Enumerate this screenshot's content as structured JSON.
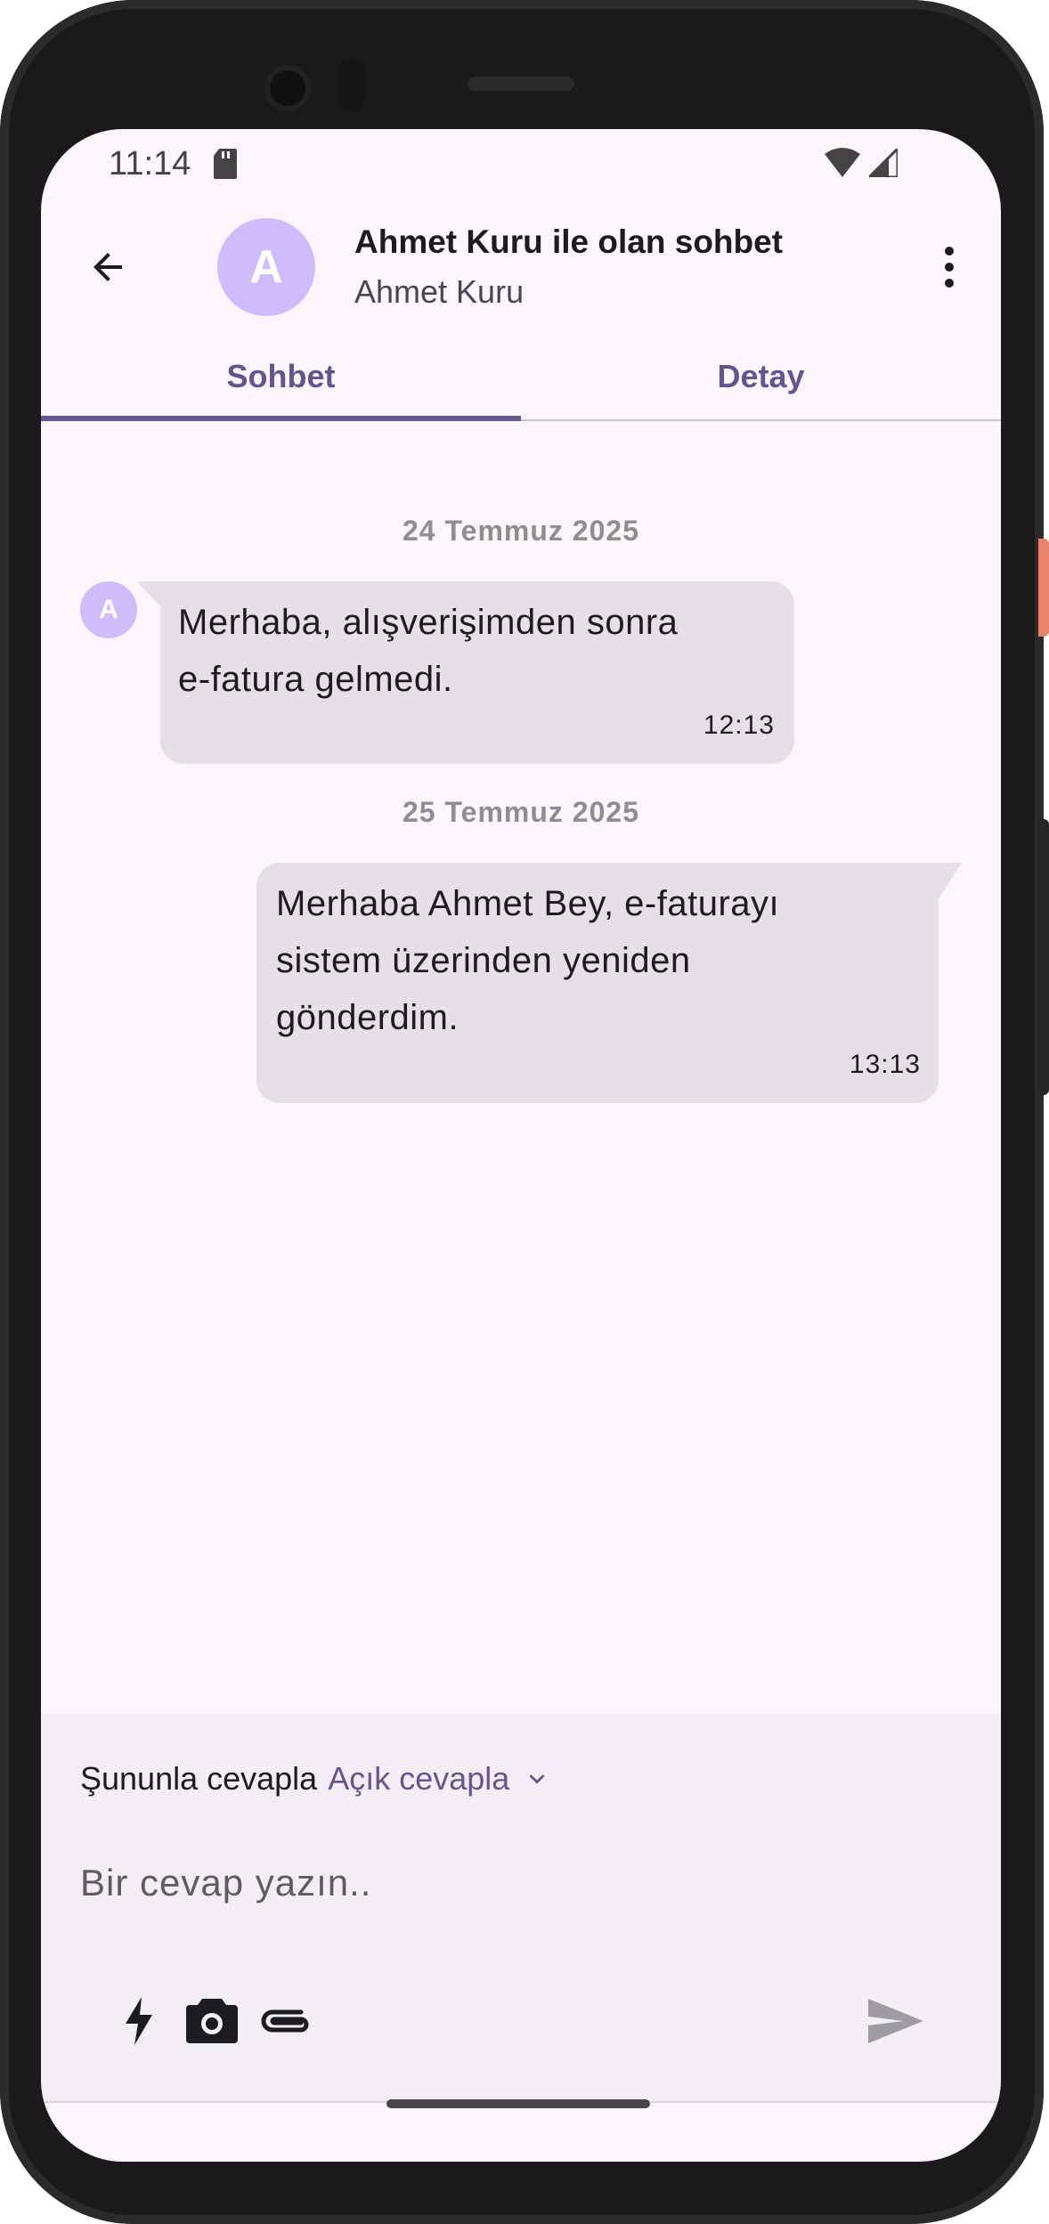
{
  "status_bar": {
    "time": "11:14"
  },
  "header": {
    "avatar_letter": "A",
    "title": "Ahmet Kuru ile olan sohbet",
    "subtitle": "Ahmet Kuru"
  },
  "tabs": [
    {
      "label": "Sohbet",
      "selected": true
    },
    {
      "label": "Detay",
      "selected": false
    }
  ],
  "messages": [
    {
      "date": "24 Temmuz 2025",
      "avatar_letter": "A",
      "lines": [
        "Merhaba, alışverişimden sonra",
        "e-fatura gelmedi."
      ],
      "time": "12:13",
      "direction": "incoming"
    },
    {
      "date": "25 Temmuz 2025",
      "lines": [
        "Merhaba Ahmet Bey, e-faturayı",
        "sistem üzerinden yeniden",
        "gönderdim."
      ],
      "time": "13:13",
      "direction": "outgoing"
    }
  ],
  "composer": {
    "reply_prefix": "Şununla cevapla",
    "reply_mode": "Açık cevapla",
    "placeholder": "Bir cevap yazın..",
    "tools": [
      "lightning-icon",
      "camera-icon",
      "attachment-icon",
      "send-icon"
    ]
  },
  "colors": {
    "accent": "#65558f",
    "avatar_bg": "#d0bcfa",
    "bubble_bg": "#e6e0e6",
    "screen_bg": "#fcf6fc"
  }
}
